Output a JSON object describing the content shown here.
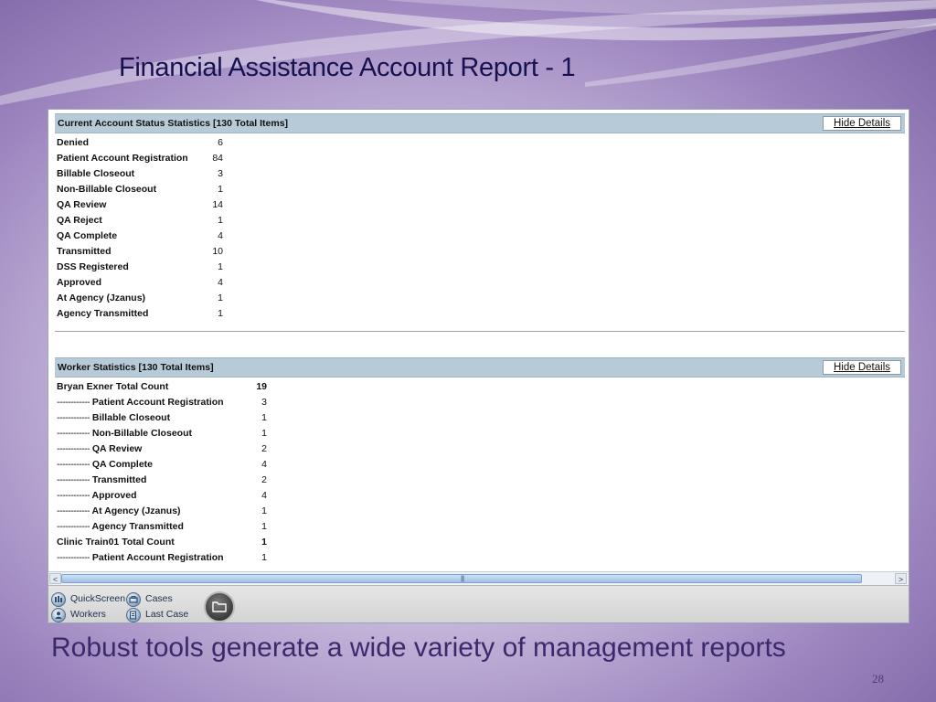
{
  "slide": {
    "title": "Financial Assistance Account Report  - 1",
    "tagline": "Robust tools generate a wide variety of management reports",
    "page_number": "28"
  },
  "account_status": {
    "header": "Current Account Status Statistics [130 Total Items]",
    "hide_label": "Hide Details",
    "rows": [
      {
        "label": "Denied",
        "value": "6"
      },
      {
        "label": "Patient Account Registration",
        "value": "84"
      },
      {
        "label": "Billable Closeout",
        "value": "3"
      },
      {
        "label": "Non-Billable Closeout",
        "value": "1"
      },
      {
        "label": "QA Review",
        "value": "14"
      },
      {
        "label": "QA Reject",
        "value": "1"
      },
      {
        "label": "QA Complete",
        "value": "4"
      },
      {
        "label": "Transmitted",
        "value": "10"
      },
      {
        "label": "DSS Registered",
        "value": "1"
      },
      {
        "label": "Approved",
        "value": "4"
      },
      {
        "label": "At Agency (Jzanus)",
        "value": "1"
      },
      {
        "label": "Agency Transmitted",
        "value": "1"
      }
    ]
  },
  "worker_stats": {
    "header": "Worker Statistics [130 Total Items]",
    "hide_label": "Hide Details",
    "dash_prefix": "------------",
    "rows": [
      {
        "label": "Bryan Exner Total Count",
        "value": "19",
        "total": true
      },
      {
        "label": "Patient Account Registration",
        "value": "3",
        "total": false
      },
      {
        "label": "Billable Closeout",
        "value": "1",
        "total": false
      },
      {
        "label": "Non-Billable Closeout",
        "value": "1",
        "total": false
      },
      {
        "label": "QA Review",
        "value": "2",
        "total": false
      },
      {
        "label": "QA Complete",
        "value": "4",
        "total": false
      },
      {
        "label": "Transmitted",
        "value": "2",
        "total": false
      },
      {
        "label": "Approved",
        "value": "4",
        "total": false
      },
      {
        "label": "At Agency (Jzanus)",
        "value": "1",
        "total": false
      },
      {
        "label": "Agency Transmitted",
        "value": "1",
        "total": false
      },
      {
        "label": "Clinic Train01 Total Count",
        "value": "1",
        "total": true
      },
      {
        "label": "Patient Account Registration",
        "value": "1",
        "total": false
      }
    ]
  },
  "scrollbar": {
    "left_arrow": "<",
    "right_arrow": ">",
    "grip": "||||"
  },
  "nav": {
    "quickscreen": "QuickScreen",
    "cases": "Cases",
    "workers": "Workers",
    "last_case": "Last Case"
  },
  "colors": {
    "header_bg": "#b7cad7",
    "title_color": "#17124f",
    "tagline_color": "#3a2a6b"
  }
}
